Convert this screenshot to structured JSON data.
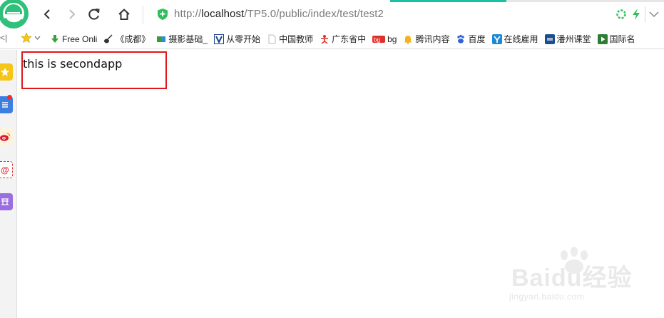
{
  "browser": {
    "address": {
      "url_prefix": "http://",
      "url_host": "localhost",
      "url_path": "/TP5.0/public/index/test/test2"
    },
    "nav_icons": [
      "back-icon",
      "forward-icon",
      "reload-icon",
      "home-icon"
    ]
  },
  "bookmarks": {
    "overflow_label": "<|",
    "items": [
      {
        "label": "Free Onli",
        "icon": "download-arrow-icon",
        "color": "#3aa13a"
      },
      {
        "label": "《成都》",
        "icon": "guitar-icon",
        "color": "#333333"
      },
      {
        "label": "摄影基础_",
        "icon": "flag-icon",
        "color": "#2a8fd8"
      },
      {
        "label": "从零开始",
        "icon": "v-logo-icon",
        "color": "#1a3f8f"
      },
      {
        "label": "中国教师",
        "icon": "page-icon",
        "color": "#bbbbbb"
      },
      {
        "label": "广东省中",
        "icon": "figure-icon",
        "color": "#e0302a"
      },
      {
        "label": "bg",
        "icon": "badge-icon",
        "color": "#e0302a"
      },
      {
        "label": "腾讯内容",
        "icon": "bell-icon",
        "color": "#f2b21c"
      },
      {
        "label": "百度",
        "icon": "paw-icon",
        "color": "#2f62d8"
      },
      {
        "label": "在线雇用",
        "icon": "y-logo-icon",
        "color": "#1a8ad6"
      },
      {
        "label": "潘州课堂",
        "icon": "square-logo-icon",
        "color": "#1b4e8f"
      },
      {
        "label": "国际名",
        "icon": "play-icon",
        "color": "#2e7d32"
      }
    ]
  },
  "sidebar": {
    "items": [
      {
        "name": "favorites-star-icon",
        "color": "#f5c518"
      },
      {
        "name": "list-icon",
        "color": "#3d7fe0"
      },
      {
        "name": "weibo-icon",
        "color": "#f0a020"
      },
      {
        "name": "mail-icon",
        "color": "#e03030"
      },
      {
        "name": "comic-icon",
        "color": "#9a6ee0"
      }
    ]
  },
  "page": {
    "text": "this is secondapp",
    "highlight_color": "#e0161d"
  },
  "watermark": {
    "brand": "Baidu经验",
    "url": "jingyan.baidu.com"
  }
}
